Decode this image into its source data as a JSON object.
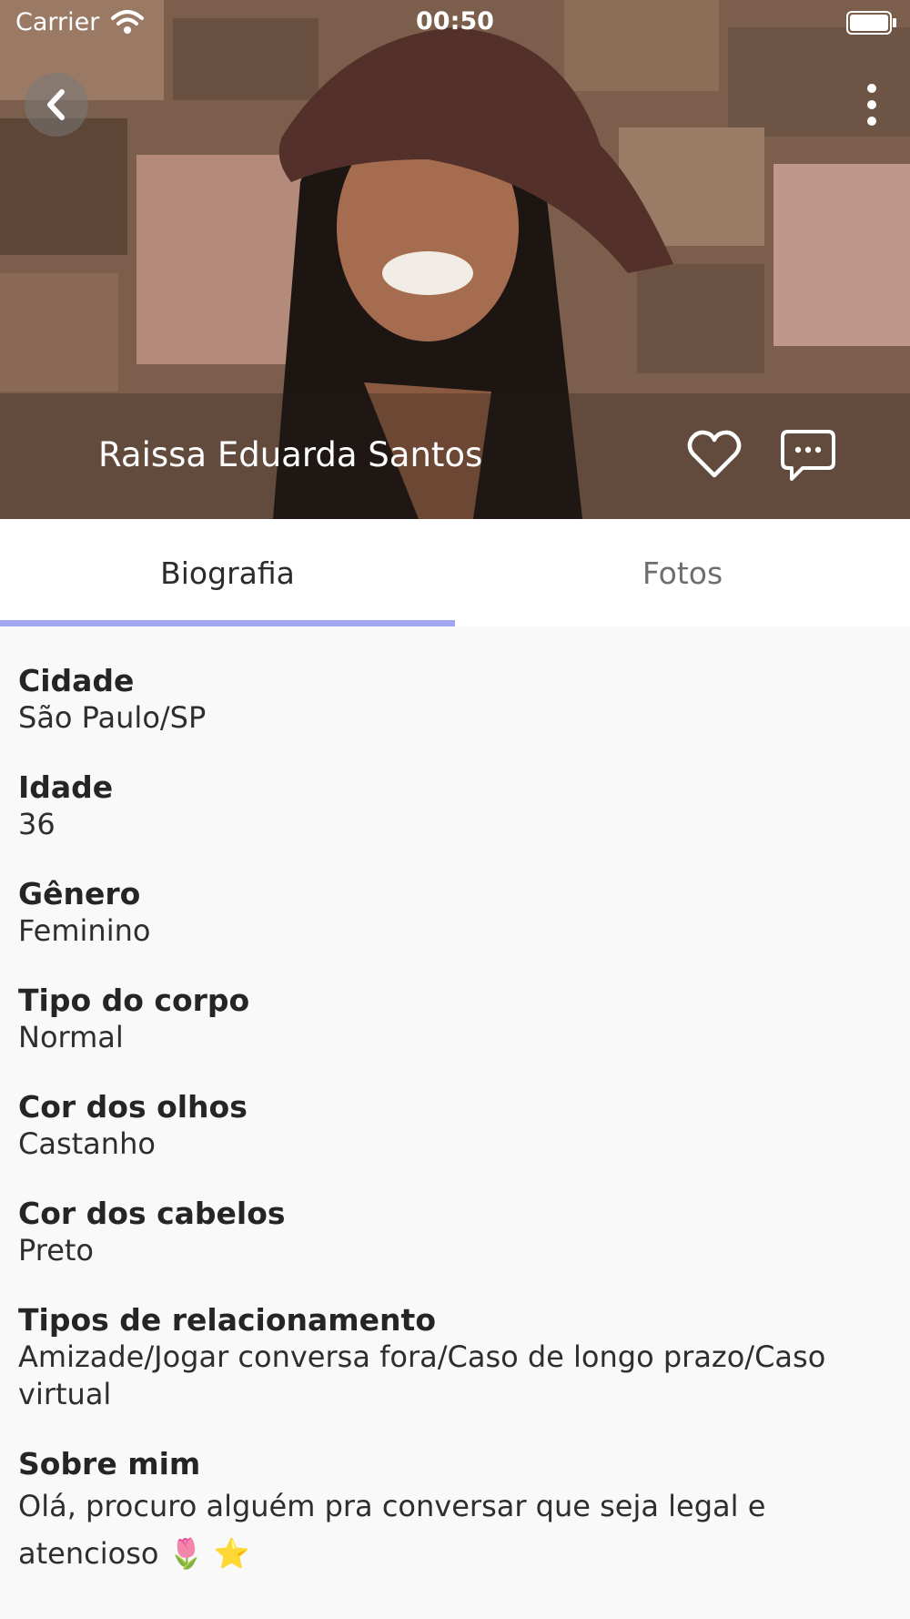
{
  "status_bar": {
    "carrier": "Carrier",
    "time": "00:50",
    "icons": [
      "wifi-icon",
      "battery-icon"
    ]
  },
  "profile": {
    "name": "Raissa Eduarda Santos",
    "icons": [
      "back-arrow-icon",
      "more-vertical-icon",
      "heart-icon",
      "chat-bubble-icon"
    ]
  },
  "tabs": {
    "items": [
      {
        "label": "Biografia",
        "active": true
      },
      {
        "label": "Fotos",
        "active": false
      }
    ],
    "indicator_color": "#a3a6f2"
  },
  "fields": [
    {
      "label": "Cidade",
      "value": "São Paulo/SP"
    },
    {
      "label": "Idade",
      "value": "36"
    },
    {
      "label": "Gênero",
      "value": "Feminino"
    },
    {
      "label": "Tipo do corpo",
      "value": "Normal"
    },
    {
      "label": "Cor dos olhos",
      "value": "Castanho"
    },
    {
      "label": "Cor dos cabelos",
      "value": "Preto"
    },
    {
      "label": "Tipos de relacionamento",
      "value": "Amizade/Jogar conversa fora/Caso de longo prazo/Caso virtual"
    },
    {
      "label": "Sobre mim",
      "value": "Olá, procuro alguém pra conversar que seja legal e atencioso 🌷 ⭐"
    }
  ],
  "colors": {
    "background": "#f9f9f9",
    "tab_active_text": "#2b2b2b",
    "tab_inactive_text": "#6e6e6e"
  }
}
